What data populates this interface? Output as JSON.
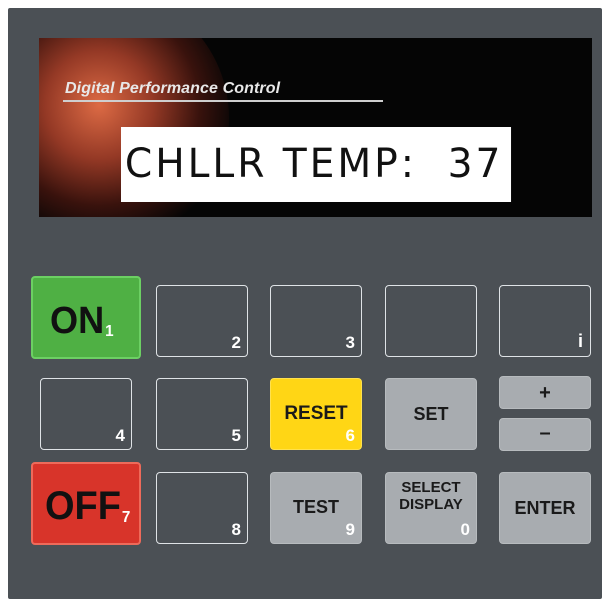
{
  "display": {
    "brand": "Digital Performance Control",
    "readout": "CHLLR TEMP:  37"
  },
  "keys": {
    "on": {
      "label": "ON",
      "num": "1"
    },
    "k2": {
      "num": "2"
    },
    "k3": {
      "num": "3"
    },
    "k4": {
      "num": "4"
    },
    "k5": {
      "num": "5"
    },
    "k8": {
      "num": "8"
    },
    "info": {
      "label": "i"
    },
    "reset": {
      "label": "RESET",
      "num": "6"
    },
    "set": {
      "label": "SET"
    },
    "plus": {
      "label": "+"
    },
    "minus": {
      "label": "–"
    },
    "off": {
      "label": "OFF",
      "num": "7"
    },
    "test": {
      "label": "TEST",
      "num": "9"
    },
    "select_display": {
      "label1": "SELECT",
      "label2": "DISPLAY",
      "num": "0"
    },
    "enter": {
      "label": "ENTER"
    }
  },
  "colors": {
    "panel": "#4b5055",
    "on_key": "#4fb044",
    "off_key": "#d8342a",
    "reset_key": "#ffd615",
    "function_key": "#a8acb0",
    "display_bg": "#050505",
    "lcd_bg": "#ffffff"
  },
  "icons": {
    "info": "info-icon"
  }
}
